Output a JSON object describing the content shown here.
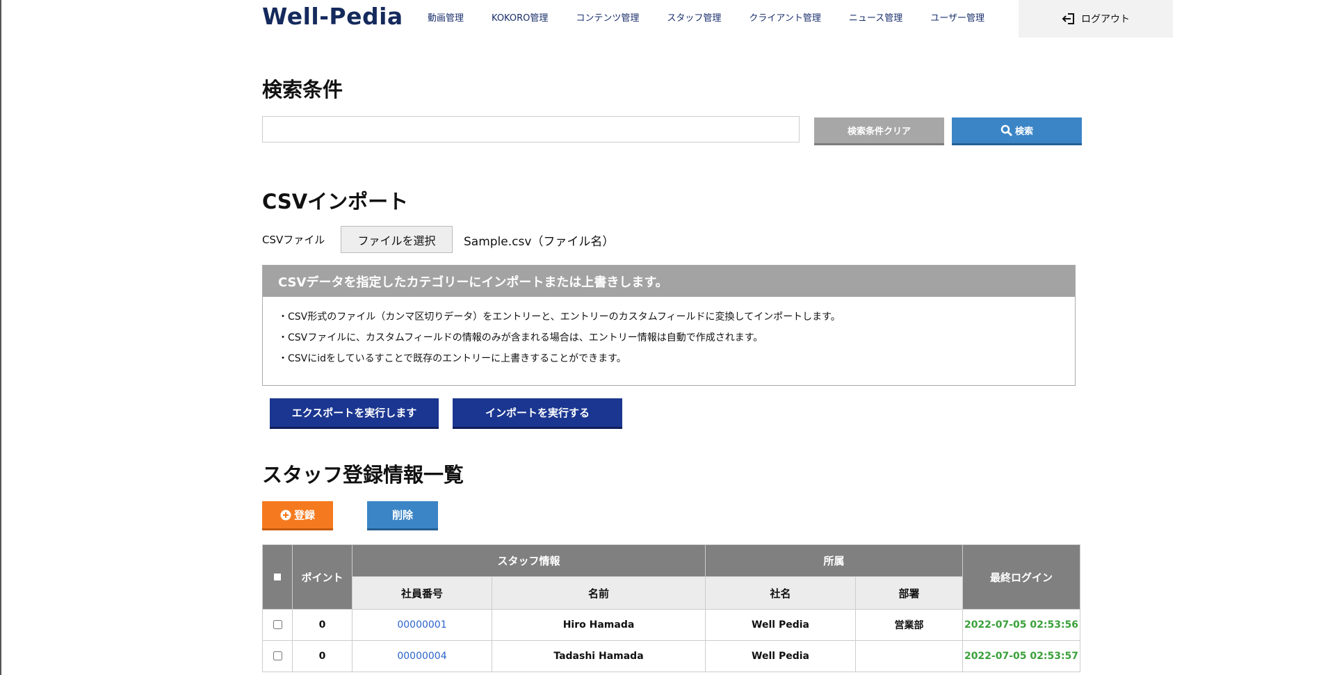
{
  "header": {
    "logo": "Well-Pedia",
    "nav": [
      "動画管理",
      "KOKORO管理",
      "コンテンツ管理",
      "スタッフ管理",
      "クライアント管理",
      "ニュース管理",
      "ユーザー管理"
    ],
    "logout_label": "ログアウト"
  },
  "search": {
    "title": "検索条件",
    "input_value": "",
    "clear_label": "検索条件クリア",
    "search_label": "検索"
  },
  "csv": {
    "title": "CSVインポート",
    "file_label": "CSVファイル",
    "file_button": "ファイルを選択",
    "file_name": "Sample.csv（ファイル名）",
    "info_title": "CSVデータを指定したカテゴリーにインポートまたは上書きします。",
    "info_lines": [
      "・CSV形式のファイル（カンマ区切りデータ）をエントリーと、エントリーのカスタムフィールドに変換してインポートします。",
      "・CSVファイルに、カスタムフィールドの情報のみが含まれる場合は、エントリー情報は自動で作成されます。",
      "・CSVにidをしているすことで既存のエントリーに上書きすることができます。"
    ],
    "export_label": "エクスポートを実行します",
    "import_label": "インポートを実行する"
  },
  "list": {
    "title": "スタッフ登録情報一覧",
    "register_label": "登録",
    "delete_label": "削除",
    "headers": {
      "point": "ポイント",
      "staff_info": "スタッフ情報",
      "affiliation": "所属",
      "last_login": "最終ログイン",
      "employee_no": "社員番号",
      "name": "名前",
      "company": "社名",
      "department": "部署"
    },
    "rows": [
      {
        "point": "0",
        "employee_no": "00000001",
        "name": "Hiro Hamada",
        "company": "Well Pedia",
        "department": "営業部",
        "last_login": "2022-07-05 02:53:56"
      },
      {
        "point": "0",
        "employee_no": "00000004",
        "name": "Tadashi Hamada",
        "company": "Well Pedia",
        "department": "",
        "last_login": "2022-07-05 02:53:57"
      }
    ]
  }
}
